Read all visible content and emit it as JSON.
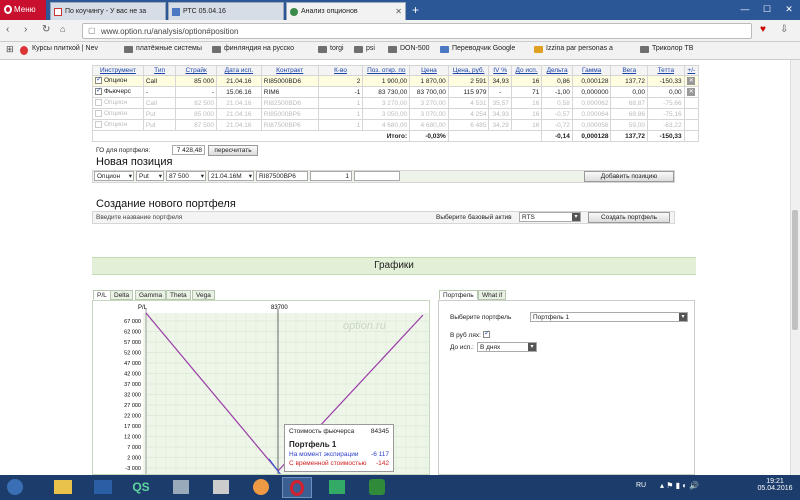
{
  "browser": {
    "menu_label": "Меню",
    "tabs": [
      {
        "title": "По коучингу - У вас не за"
      },
      {
        "title": "РТС 05.04.16"
      },
      {
        "title": "Анализ опционов"
      }
    ],
    "url": "www.option.ru/analysis/option#position",
    "bookmarks": [
      "Курсы плиткой | Nev",
      "платёжные системы",
      "финляндия на русско",
      "torgi",
      "psi",
      "DON-500",
      "Переводчик Google",
      "Izzina par personas a",
      "Триколор ТВ"
    ]
  },
  "positions": {
    "headers": [
      "Инструмент",
      "Тип",
      "Страйк",
      "Дата исп.",
      "Контракт",
      "К-во",
      "Поз. откр. по",
      "Цена",
      "Цена, руб.",
      "IV %",
      "До исп.",
      "Дельта",
      "Гамма",
      "Вега",
      "Тетта",
      "+/-"
    ],
    "rows": [
      {
        "instrument": "Опцион",
        "type": "Call",
        "strike": "85 000",
        "date": "21.04.16",
        "contract": "RI85000BD6",
        "qty": "2",
        "open": "1 900,00",
        "price": "1 870,00",
        "price_rub": "2 591",
        "iv": "34,93",
        "days": "16",
        "delta": "0,86",
        "gamma": "0,000128",
        "vega": "137,72",
        "theta": "-150,33"
      },
      {
        "instrument": "Фьючерс",
        "type": "-",
        "strike": "-",
        "date": "15.06.16",
        "contract": "RIM6",
        "qty": "-1",
        "open": "83 730,00",
        "price": "83 700,00",
        "price_rub": "115 979",
        "iv": "-",
        "days": "71",
        "delta": "-1,00",
        "gamma": "0,000000",
        "vega": "0,00",
        "theta": "0,00"
      },
      {
        "instrument": "Опцион",
        "type": "Call",
        "strike": "82 500",
        "date": "21.04.16",
        "contract": "RI82500BD6",
        "qty": "1",
        "open": "3 270,00",
        "price": "3 270,00",
        "price_rub": "4 531",
        "iv": "35,57",
        "days": "16",
        "delta": "0,58",
        "gamma": "0,000062",
        "vega": "68,87",
        "theta": "-75,66"
      },
      {
        "instrument": "Опцион",
        "type": "Put",
        "strike": "85 000",
        "date": "21.04.16",
        "contract": "RI85000BP6",
        "qty": "1",
        "open": "3 050,00",
        "price": "3 070,00",
        "price_rub": "4 254",
        "iv": "34,93",
        "days": "16",
        "delta": "-0,57",
        "gamma": "0,000064",
        "vega": "68,86",
        "theta": "-75,16"
      },
      {
        "instrument": "Опцион",
        "type": "Put",
        "strike": "87 500",
        "date": "21.04.16",
        "contract": "RI87500BP6",
        "qty": "1",
        "open": "4 680,00",
        "price": "4 680,00",
        "price_rub": "6 485",
        "iv": "34,29",
        "days": "16",
        "delta": "-0,72",
        "gamma": "0,000056",
        "vega": "59,00",
        "theta": "-63,22"
      }
    ],
    "totals": {
      "label": "Итого:",
      "pct": "-0,03%",
      "delta": "-0,14",
      "gamma": "0,000128",
      "vega": "137,72",
      "theta": "-150,33"
    },
    "go_label": "ГО для портфеля:",
    "go_value": "7 428,48",
    "recalc_button": "пересчитать"
  },
  "new_position": {
    "title": "Новая позиция",
    "instrument": "Опцион",
    "type": "Put",
    "strike": "87 500",
    "date": "21.04.16M",
    "contract": "RI87500BP6",
    "qty": "1",
    "add_button": "Добавить позицию"
  },
  "new_portfolio": {
    "title": "Создание нового портфеля",
    "name_placeholder": "Введите название портфеля",
    "base_label": "Выберите базовый актив",
    "base_value": "RTS",
    "create_button": "Создать портфель"
  },
  "charts": {
    "section_title": "Графики",
    "tabs": [
      "P/L",
      "Delta",
      "Gamma",
      "Theta",
      "Vega"
    ],
    "y_label": "P/L",
    "x_marker": "83700",
    "watermark": "option.ru",
    "y_ticks": [
      "67 000",
      "62 000",
      "57 000",
      "52 000",
      "47 000",
      "42 000",
      "37 000",
      "32 000",
      "27 000",
      "22 000",
      "17 000",
      "12 000",
      "7 000",
      "2 000",
      "-3 000"
    ],
    "tooltip": {
      "future_label": "Стоимость фьючерса",
      "future_value": "84345",
      "portfolio": "Портфель 1",
      "expiry_label": "На момент экспирации",
      "expiry_value": "-6 117",
      "time_label": "С временной стоимостью",
      "time_value": "-142"
    }
  },
  "right_panel": {
    "tabs": [
      "Портфель",
      "What if"
    ],
    "choose_label": "Выберите портфель",
    "choose_value": "Портфель 1",
    "rub_label": "В руб лях:",
    "until_label": "До исп.:",
    "until_value": "В днях"
  },
  "taskbar": {
    "lang": "RU",
    "time": "19:21",
    "date": "05.04.2016"
  }
}
